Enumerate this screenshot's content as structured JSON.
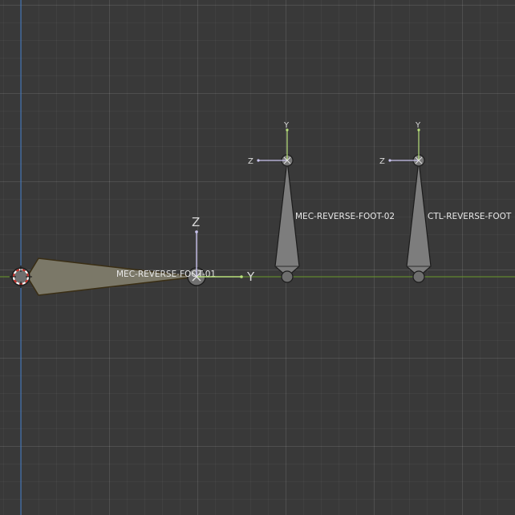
{
  "colors": {
    "background": "#393939",
    "axis_y_line": "#6a9a2a",
    "axis_z_line": "#3f6fb0",
    "bone_fill": "#7d7d7d",
    "bone_outline": "#1c1c1c",
    "selected_outline": "#4a3a20",
    "gizmo_y": "#b7e07a",
    "gizmo_z": "#c9c3ee",
    "cursor_red": "#c8302a"
  },
  "bones": [
    {
      "label": "MEC-REVERSE-FOOT-01"
    },
    {
      "label": "MEC-REVERSE-FOOT-02"
    },
    {
      "label": "CTL-REVERSE-FOOT"
    }
  ],
  "gizmo": {
    "main": {
      "z_label": "Z",
      "y_label": "Y"
    },
    "bone2": {
      "y_label": "Y",
      "z_label": "Z"
    },
    "bone3": {
      "y_label": "Y",
      "z_label": "Z"
    }
  }
}
